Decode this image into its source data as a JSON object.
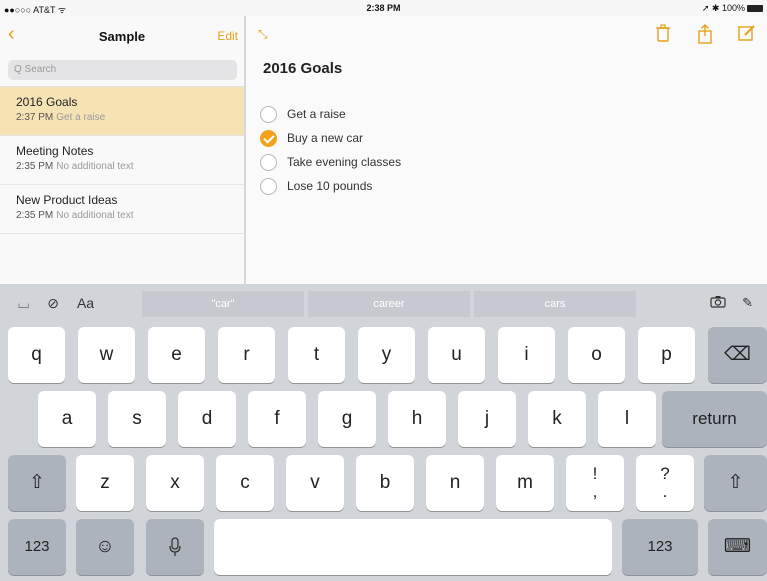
{
  "status_bar": {
    "carrier": "●●○○○ AT&T ᯤ",
    "time": "2:38 PM",
    "battery_text": "➚ ✱ 100%"
  },
  "sidebar": {
    "back_icon": "chevron-left-icon",
    "title": "Sample",
    "edit_label": "Edit",
    "search_placeholder": "Q Search",
    "notes": [
      {
        "title": "2016 Goals",
        "time": "2:37 PM",
        "preview": "Get a raise",
        "selected": true
      },
      {
        "title": "Meeting Notes",
        "time": "2:35 PM",
        "preview": "No additional text",
        "selected": false
      },
      {
        "title": "New Product Ideas",
        "time": "2:35 PM",
        "preview": "No additional text",
        "selected": false
      }
    ]
  },
  "note": {
    "heading": "2016 Goals",
    "checklist": [
      {
        "label": "Get a raise",
        "checked": false
      },
      {
        "label": "Buy a new car",
        "checked": true
      },
      {
        "label": "Take evening classes",
        "checked": false
      },
      {
        "label": "Lose 10 pounds",
        "checked": false
      }
    ]
  },
  "toolbar_icons": [
    "trash-icon",
    "share-icon",
    "compose-icon"
  ],
  "accent_color": "#e2a21b",
  "keyboard": {
    "tools_left": {
      "table": "⌴",
      "check": "⊘",
      "format": "Aa"
    },
    "suggestions": [
      "\"car\"",
      "career",
      "cars"
    ],
    "tools_right": {
      "camera": "📷",
      "sketch": "✎"
    },
    "row1": [
      "q",
      "w",
      "e",
      "r",
      "t",
      "y",
      "u",
      "i",
      "o",
      "p"
    ],
    "backspace": "⌫",
    "row2": [
      "a",
      "s",
      "d",
      "f",
      "g",
      "h",
      "j",
      "k",
      "l"
    ],
    "return": "return",
    "shift": "⇧",
    "row3": [
      "z",
      "x",
      "c",
      "v",
      "b",
      "n",
      "m"
    ],
    "punct1": {
      "top": "!",
      "bottom": ","
    },
    "punct2": {
      "top": "?",
      "bottom": "."
    },
    "numbers": "123",
    "emoji": "☺",
    "mic": "🎙",
    "hide": "⌨"
  }
}
